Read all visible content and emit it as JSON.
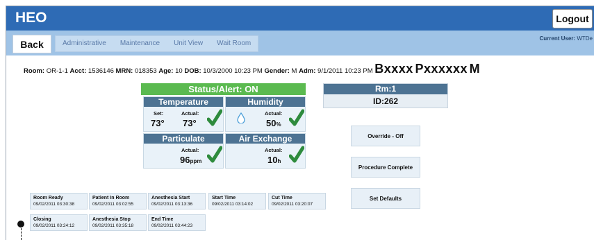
{
  "app": {
    "title": "HEO",
    "logout_label": "Logout"
  },
  "nav": {
    "back_label": "Back",
    "tabs": [
      "Administrative",
      "Maintenance",
      "Unit View",
      "Wait Room"
    ],
    "current_user_label": "Current User:",
    "current_user_value": "WTDe"
  },
  "patient": {
    "room_label": "Room:",
    "room": "OR-1-1",
    "acct_label": "Acct:",
    "acct": "1536146",
    "mrn_label": "MRN:",
    "mrn": "018353",
    "age_label": "Age:",
    "age": "10",
    "dob_label": "DOB:",
    "dob": "10/3/2000 10:23 PM",
    "gender_label": "Gender:",
    "gender": "M",
    "adm_label": "Adm:",
    "adm": "9/1/2011 10:23 PM",
    "name_first": "Bxxxx",
    "name_last": "Pxxxxxx",
    "sex": "M"
  },
  "status": {
    "text": "Status/Alert: ON"
  },
  "sensors": {
    "temperature": {
      "title": "Temperature",
      "set_label": "Set:",
      "set": "73°",
      "actual_label": "Actual:",
      "actual": "73°"
    },
    "humidity": {
      "title": "Humidity",
      "actual_label": "Actual:",
      "actual": "50",
      "unit": "%"
    },
    "particulate": {
      "title": "Particulate",
      "actual_label": "Actual:",
      "actual": "96",
      "unit": "ppm"
    },
    "air_exchange": {
      "title": "Air Exchange",
      "actual_label": "Actual:",
      "actual": "10",
      "unit": "h"
    }
  },
  "room_panel": {
    "rm": "Rm:1",
    "id": "ID:262"
  },
  "actions": {
    "override": "Override - Off",
    "procedure": "Procedure Complete",
    "defaults": "Set Defaults"
  },
  "timeline": [
    {
      "label": "Room Ready",
      "time": "09/02/2011 03:30:38"
    },
    {
      "label": "Patient In Room",
      "time": "09/02/2011 03:02:55"
    },
    {
      "label": "Anesthesia Start",
      "time": "09/02/2011 03:13:36"
    },
    {
      "label": "Start Time",
      "time": "09/02/2011 03:14:02"
    },
    {
      "label": "Cut Time",
      "time": "09/02/2011 03:20:07"
    },
    {
      "label": "Closing",
      "time": "09/02/2011 03:24:12"
    },
    {
      "label": "Anesthesia Stop",
      "time": "09/02/2011 03:35:18"
    },
    {
      "label": "End Time",
      "time": "09/02/2011 03:44:23"
    }
  ],
  "colors": {
    "header_blue": "#2e6bb5",
    "nav_blue": "#9fc3e6",
    "status_green": "#5bba50",
    "panel_header": "#4d7393",
    "check_green": "#2e8b3d"
  }
}
